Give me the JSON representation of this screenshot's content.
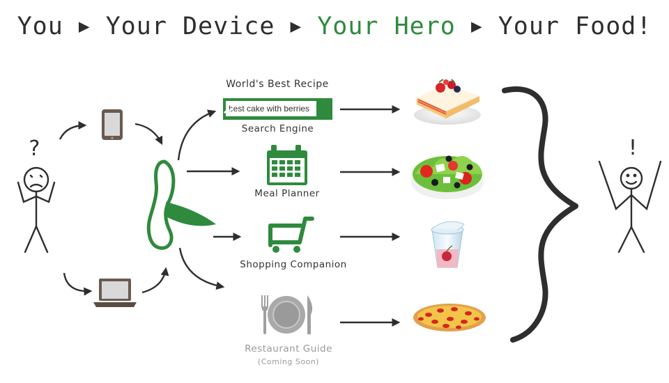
{
  "title": {
    "you": "You",
    "device": "Your Device",
    "hero": "Your Hero",
    "food": "Your Food!",
    "separator": "▶"
  },
  "user": {
    "question_mark": "?",
    "exclamation_mark": "!"
  },
  "features": {
    "search": {
      "heading": "World's Best Recipe",
      "query": "best cake with berries",
      "label": "Search Engine"
    },
    "meal_planner": {
      "label": "Meal Planner"
    },
    "shopping": {
      "label": "Shopping Companion"
    },
    "restaurant": {
      "label": "Restaurant Guide",
      "note": "(Coming Soon)"
    }
  },
  "colors": {
    "brand_green": "#2f8a3e",
    "ink": "#2e2e2e",
    "muted": "#9a9a9a"
  },
  "icons": {
    "devices": [
      "tablet-icon",
      "laptop-icon"
    ],
    "hero": "hero-logo-icon",
    "features": [
      "search-icon",
      "calendar-icon",
      "shopping-cart-icon",
      "plate-cutlery-icon"
    ],
    "foods": [
      "cake-icon",
      "salad-icon",
      "yogurt-cup-icon",
      "pizza-icon"
    ]
  }
}
